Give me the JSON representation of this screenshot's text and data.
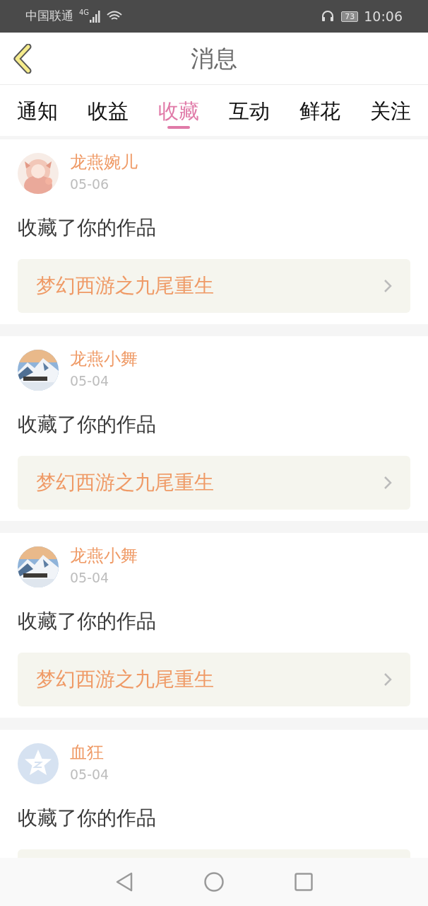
{
  "status_bar": {
    "carrier": "中国联通",
    "network": "4G",
    "battery": "73",
    "time": "10:06"
  },
  "header": {
    "title": "消息"
  },
  "tabs": [
    {
      "label": "通知",
      "selected": false
    },
    {
      "label": "收益",
      "selected": false
    },
    {
      "label": "收藏",
      "selected": true
    },
    {
      "label": "互动",
      "selected": false
    },
    {
      "label": "鲜花",
      "selected": false
    },
    {
      "label": "关注",
      "selected": false
    }
  ],
  "messages": [
    {
      "name": "龙燕婉儿",
      "date": "05-06",
      "text": "收藏了你的作品",
      "work": "梦幻西游之九尾重生"
    },
    {
      "name": "龙燕小舞",
      "date": "05-04",
      "text": "收藏了你的作品",
      "work": "梦幻西游之九尾重生"
    },
    {
      "name": "龙燕小舞",
      "date": "05-04",
      "text": "收藏了你的作品",
      "work": "梦幻西游之九尾重生"
    },
    {
      "avatar": {
        "kind": "default"
      },
      "name": "血狂",
      "date": "05-04",
      "text": "收藏了你的作品"
    }
  ]
}
